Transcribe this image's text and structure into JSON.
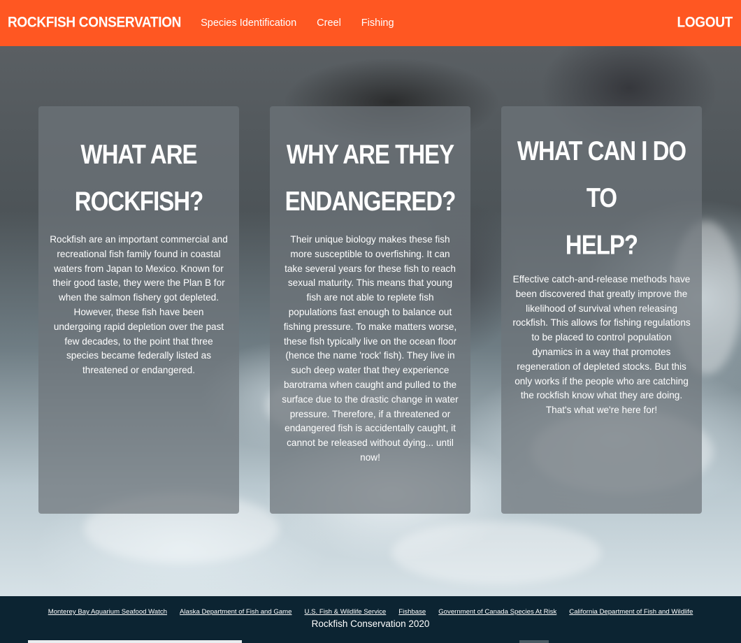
{
  "navbar": {
    "brand": "ROCKFISH CONSERVATION",
    "links": [
      "Species Identification",
      "Creel",
      "Fishing"
    ],
    "logout": "LOGOUT",
    "color": "#ff5722"
  },
  "cards": [
    {
      "title_line1": "WHAT ARE",
      "title_line2": "ROCKFISH?",
      "body": "Rockfish are an important commercial and recreational fish family found in coastal waters from Japan to Mexico. Known for their good taste, they were the Plan B for when the salmon fishery got depleted. However, these fish have been undergoing rapid depletion over the past few decades, to the point that three species became federally listed as threatened or endangered."
    },
    {
      "title_line1": "WHY ARE THEY",
      "title_line2": "ENDANGERED?",
      "body": "Their unique biology makes these fish more susceptible to overfishing. It can take several years for these fish to reach sexual maturity. This means that young fish are not able to replete fish populations fast enough to balance out fishing pressure. To make matters worse, these fish typically live on the ocean floor (hence the name 'rock' fish). They live in such deep water that they experience barotrama when caught and pulled to the surface due to the drastic change in water pressure. Therefore, if a threatened or endangered fish is accidentally caught, it cannot be released without dying... until now!"
    },
    {
      "title_line1": "WHAT CAN I DO TO",
      "title_line2": "HELP?",
      "body": "Effective catch-and-release methods have been discovered that greatly improve the likelihood of survival when releasing rockfish. This allows for fishing regulations to be placed to control population dynamics in a way that promotes regeneration of depleted stocks. But this only works if the people who are catching the rockfish know what they are doing. That's what we're here for!"
    }
  ],
  "footer": {
    "links": [
      "Monterey Bay Aquarium Seafood Watch",
      "Alaska Department of Fish and Game",
      "U.S. Fish & Wildlife Service",
      "Fishbase",
      "Government of Canada Species At Risk",
      "California Department of Fish and Wildlife"
    ],
    "copyright": "Rockfish Conservation 2020",
    "color": "#0c2432"
  }
}
